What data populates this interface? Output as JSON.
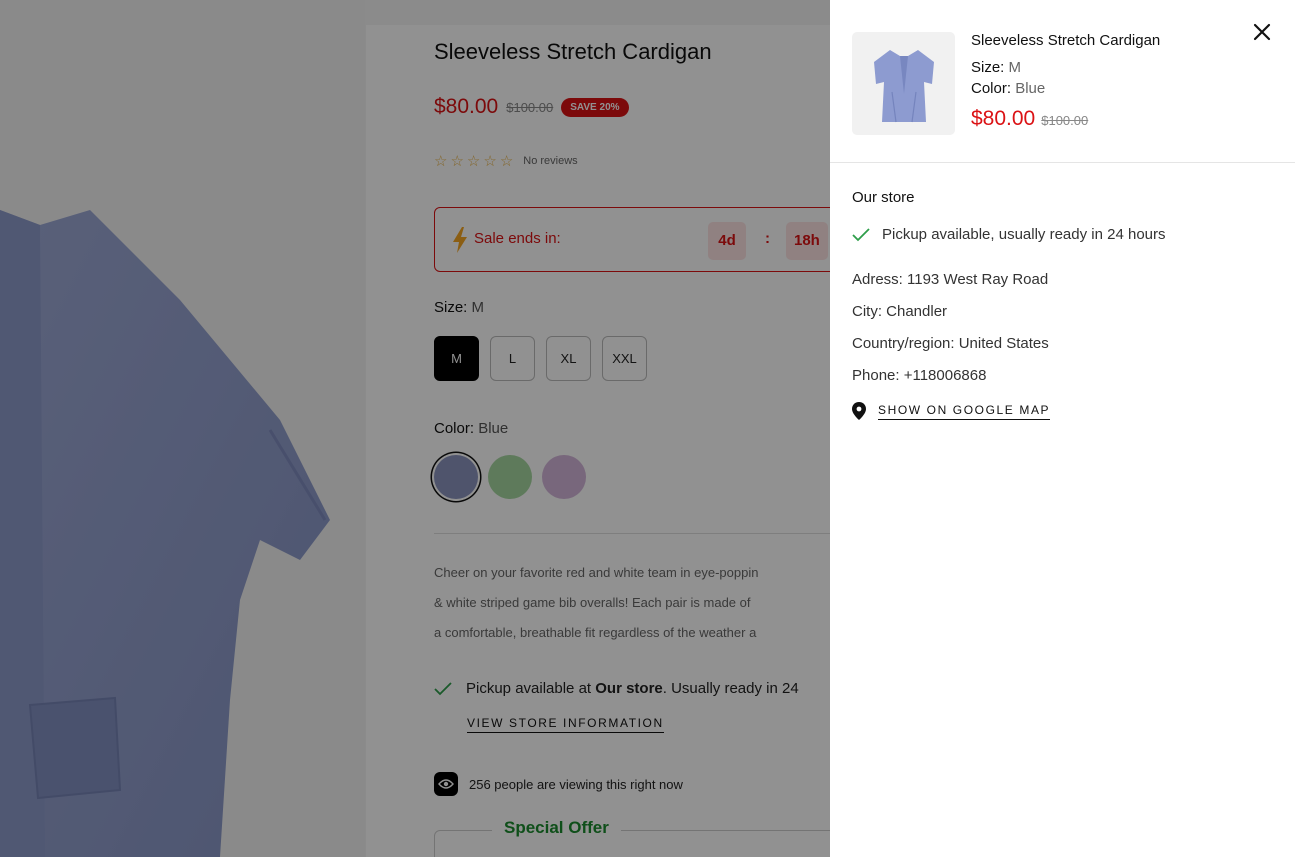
{
  "product": {
    "title": "Sleeveless Stretch Cardigan",
    "price": "$80.00",
    "compare_price": "$100.00",
    "save_badge": "SAVE 20%",
    "rating_stars": 0,
    "reviews_text": "No reviews",
    "sale": {
      "label": "Sale ends in:",
      "days": "4d",
      "separator": ":",
      "hours": "18h"
    },
    "size_label": "Size:",
    "size_value": "M",
    "sizes": [
      "M",
      "L",
      "XL",
      "XXL"
    ],
    "color_label": "Color:",
    "color_value": "Blue",
    "swatches": [
      {
        "name": "Blue",
        "hex": "#8c94bf"
      },
      {
        "name": "Green",
        "hex": "#a6d6a0"
      },
      {
        "name": "Purple",
        "hex": "#d3b5da"
      }
    ],
    "description": [
      "Cheer on your favorite red and white team in eye-poppin",
      "& white striped game bib overalls! Each pair is made of",
      "a comfortable, breathable fit regardless of the weather a"
    ],
    "pickup": {
      "prefix": "Pickup available at",
      "store": "Our store",
      "suffix": ". Usually ready in 24",
      "link": "VIEW STORE INFORMATION"
    },
    "viewers_text": "256 people are viewing this right now",
    "special_offer": "Special Offer"
  },
  "drawer": {
    "title": "Sleeveless Stretch Cardigan",
    "size_label": "Size:",
    "size_value": "M",
    "color_label": "Color:",
    "color_value": "Blue",
    "price": "$80.00",
    "compare_price": "$100.00",
    "store_name": "Our store",
    "pickup_text": "Pickup available, usually ready in 24 hours",
    "address": "Adress: 1193 West Ray Road",
    "city": "City: Chandler",
    "country": "Country/region: United States",
    "phone": "Phone: +118006868",
    "map_link": "SHOW ON GOOGLE MAP"
  },
  "colors": {
    "sale_red": "#db1215",
    "offer_green": "#1c8c2e",
    "check_green": "#2e9e4a",
    "star_gold": "#e8b44a"
  },
  "icons": [
    "close-icon",
    "check-icon",
    "location-pin-icon",
    "lightning-icon",
    "eye-icon",
    "star-icon"
  ]
}
